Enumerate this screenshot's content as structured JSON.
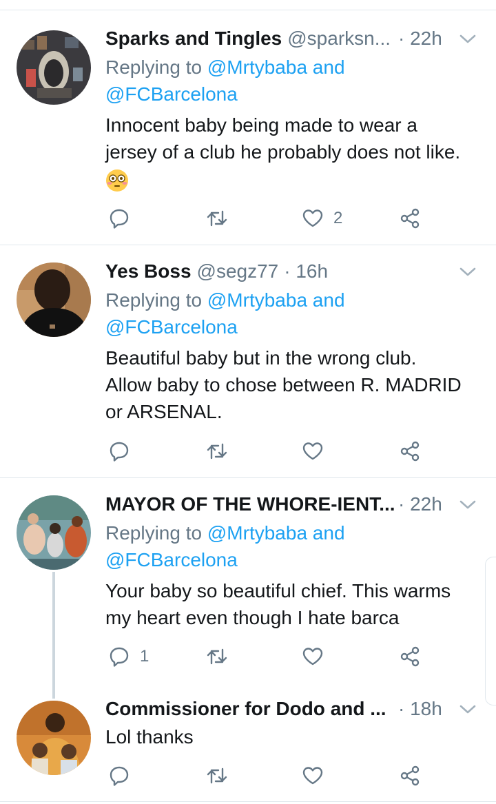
{
  "tweets": [
    {
      "name": "Sparks and Tingles",
      "handle": "@sparksn...",
      "time": "· 22h",
      "replying_prefix": "Replying to ",
      "replying_to_1": "@Mrtybaba",
      "replying_and": " and",
      "replying_to_2": "@FCBarcelona",
      "text_lines": [
        "Innocent baby being made to wear a",
        "jersey of a club he probably does not like."
      ],
      "emoji": "flushed-face-emoji",
      "reply_count": "",
      "retweet_count": "",
      "like_count": "2"
    },
    {
      "name": "Yes Boss",
      "handle": "@segz77",
      "time": "· 16h",
      "replying_prefix": "Replying to ",
      "replying_to_1": "@Mrtybaba",
      "replying_and": " and",
      "replying_to_2": "@FCBarcelona",
      "text_lines": [
        "Beautiful baby but in the wrong club.",
        "Allow baby to chose between R. MADRID",
        "or ARSENAL."
      ],
      "reply_count": "",
      "retweet_count": "",
      "like_count": ""
    },
    {
      "name": "MAYOR OF THE WHORE-IENT...",
      "handle": "",
      "time": "· 22h",
      "replying_prefix": "Replying to ",
      "replying_to_1": "@Mrtybaba",
      "replying_and": " and",
      "replying_to_2": "@FCBarcelona",
      "text_lines": [
        "Your baby so beautiful chief. This warms",
        "my heart even though I hate barca"
      ],
      "reply_count": "1",
      "retweet_count": "",
      "like_count": ""
    },
    {
      "name": "Commissioner for Dodo and ...",
      "handle": "",
      "time": "· 18h",
      "text_lines": [
        "Lol thanks"
      ],
      "reply_count": "",
      "retweet_count": "",
      "like_count": ""
    }
  ],
  "colors": {
    "link": "#1da1f2",
    "secondary_text": "#657786",
    "divider": "#e1e8ed",
    "thread_line": "#ccd6dd"
  },
  "icons": [
    "reply-icon",
    "retweet-icon",
    "like-icon",
    "share-icon",
    "chevron-down-icon"
  ]
}
